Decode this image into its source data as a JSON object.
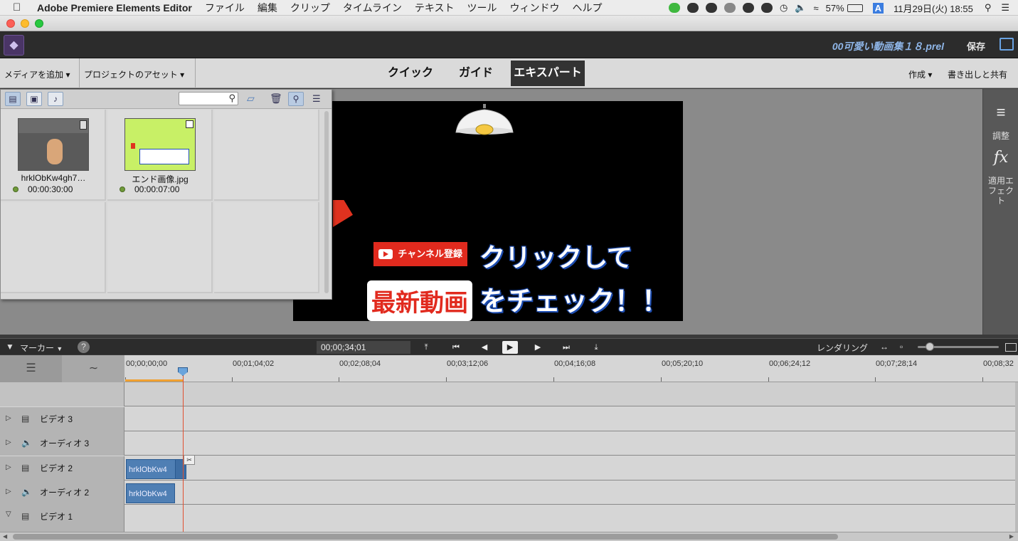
{
  "menubar": {
    "app_name": "Adobe Premiere Elements Editor",
    "items": [
      "ファイル",
      "編集",
      "クリップ",
      "タイムライン",
      "テキスト",
      "ツール",
      "ウィンドウ",
      "ヘルプ"
    ],
    "battery": "57%",
    "input_mode": "A",
    "datetime": "11月29日(火)  18:55"
  },
  "window": {
    "buttons": [
      "close",
      "minimize",
      "zoom"
    ]
  },
  "appbar": {
    "project_name": "00可愛い動画集１８.prel",
    "save_label": "保存"
  },
  "toolbar": {
    "add_media": "メディアを追加",
    "project_assets": "プロジェクトのアセット",
    "modes": [
      "クイック",
      "ガイド",
      "エキスパート"
    ],
    "active_mode": "エキスパート",
    "create": "作成",
    "export_share": "書き出しと共有"
  },
  "right_panel": {
    "adjust": "調整",
    "applied_effects": "適用エフェクト"
  },
  "assets": [
    {
      "name": "hrklObKw4gh7…",
      "duration": "00:00:30:00",
      "type": "video"
    },
    {
      "name": "エンド画像.jpg",
      "duration": "00:00:07:00",
      "type": "image"
    }
  ],
  "monitor": {
    "badge": "チャンネル登録",
    "line1": "クリックして",
    "line2_highlight": "最新動画",
    "line2": "をチェック！！"
  },
  "timeline": {
    "marker_label": "マーカー",
    "timecode": "00;00;34;01",
    "render_label": "レンダリング",
    "ruler": [
      "00;00;00;00",
      "00;01;04;02",
      "00;02;08;04",
      "00;03;12;06",
      "00;04;16;08",
      "00;05;20;10",
      "00;06;24;12",
      "00;07;28;14",
      "00;08;32"
    ],
    "tracks": [
      {
        "name": "ビデオ 3",
        "kind": "video",
        "expanded": false
      },
      {
        "name": "オーディオ 3",
        "kind": "audio",
        "expanded": false
      },
      {
        "name": "ビデオ 2",
        "kind": "video",
        "expanded": false
      },
      {
        "name": "オーディオ 2",
        "kind": "audio",
        "expanded": false
      },
      {
        "name": "ビデオ 1",
        "kind": "video",
        "expanded": true
      }
    ],
    "clips": [
      {
        "track": "ビデオ 2",
        "label": "hrklObKw4"
      },
      {
        "track": "オーディオ 2",
        "label": "hrklObKw4"
      }
    ]
  }
}
